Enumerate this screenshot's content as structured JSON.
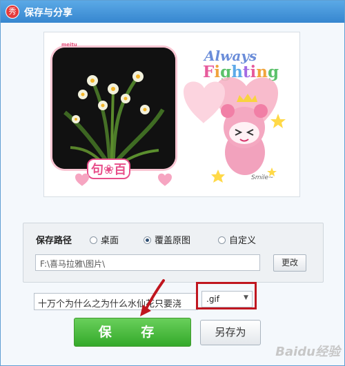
{
  "window": {
    "title": "保存与分享",
    "app_icon_text": "秀"
  },
  "preview": {
    "stamp": "meitu",
    "sticker_text": "句❀百",
    "always_text": "Always",
    "fighting_text": "Fighting",
    "smile_text": "Smile~"
  },
  "settings": {
    "save_path_label": "保存路径",
    "options": [
      {
        "label": "桌面",
        "selected": false
      },
      {
        "label": "覆盖原图",
        "selected": true
      },
      {
        "label": "自定义",
        "selected": false
      }
    ],
    "path_value": "F:\\喜马拉雅\\图片\\",
    "change_button": "更改"
  },
  "file": {
    "filename_value": "十万个为什么之为什么水仙花只要浇",
    "format_value": ".gif"
  },
  "actions": {
    "save_button": "保 存",
    "save_as_button": "另存为"
  },
  "watermark": "Baidu经验",
  "colors": {
    "titlebar": "#3f8fd6",
    "save_button": "#45b93a",
    "highlight": "#c0161f"
  }
}
